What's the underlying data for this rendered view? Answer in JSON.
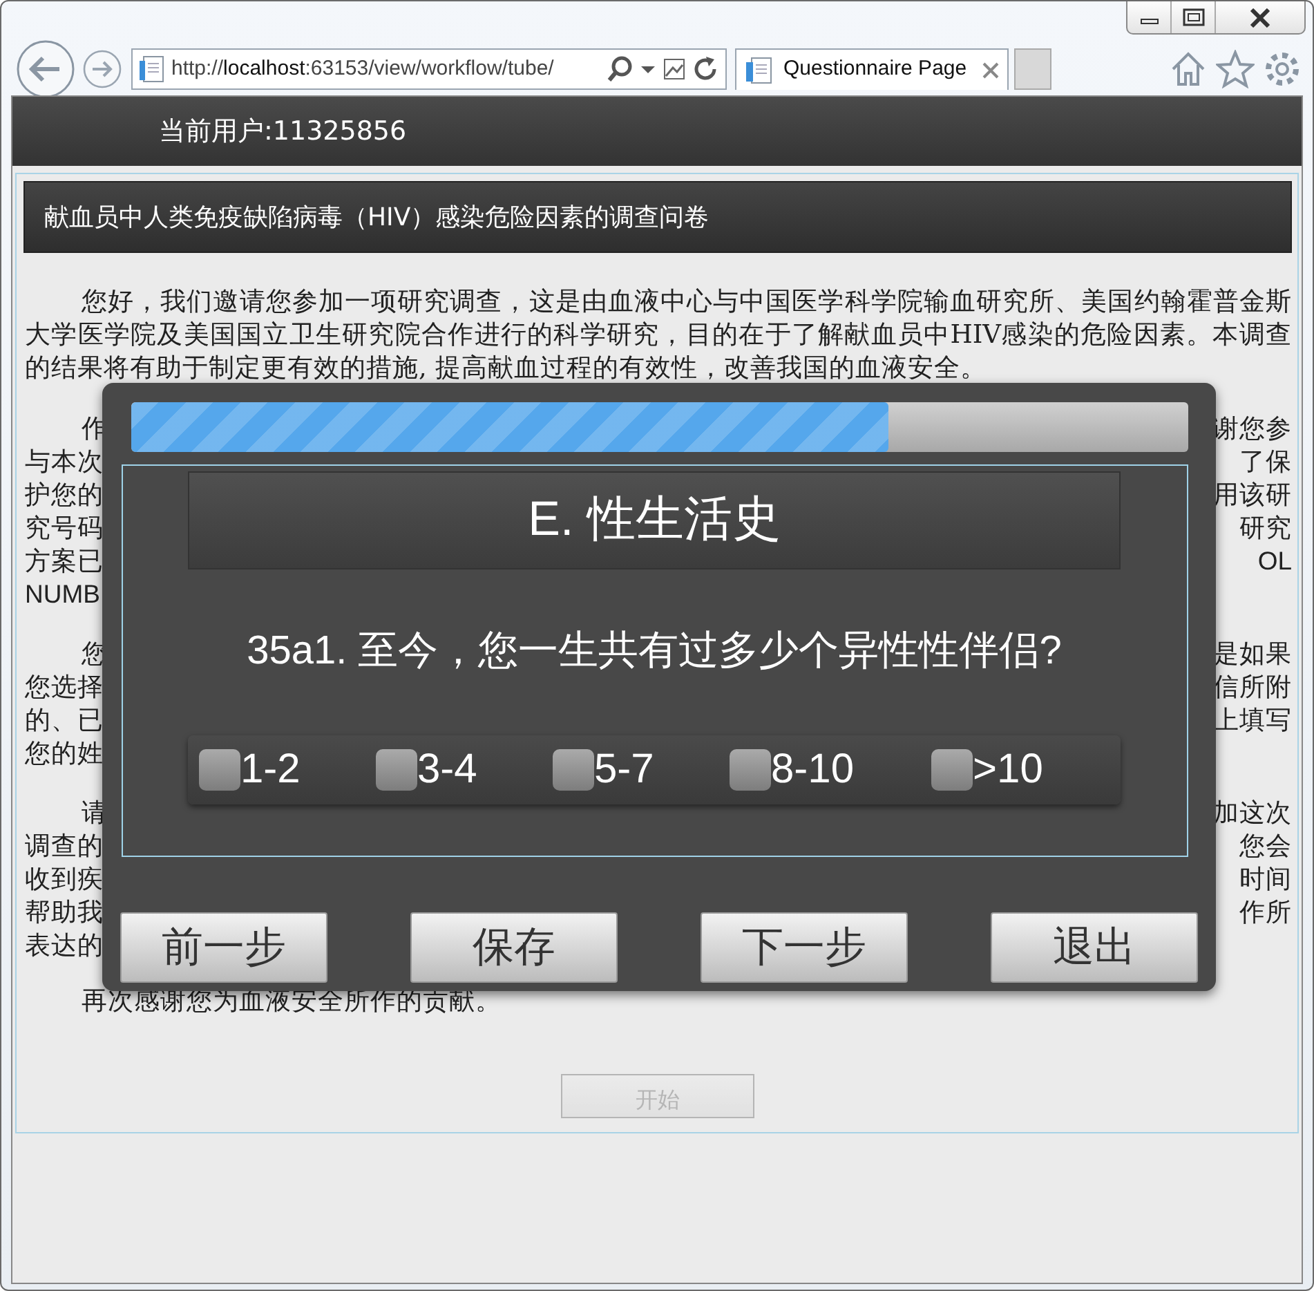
{
  "browser": {
    "address": "http://**localhost**:63153/view/workflow/tube/",
    "tabs": [
      {
        "title": "Questionnaire Page",
        "selected": true
      }
    ]
  },
  "header": {
    "user_label": "当前用户:11325856"
  },
  "survey": {
    "title": "献血员中人类免疫缺陷病毒（HIV）感染危险因素的调查问卷",
    "intro": "您好，我们邀请您参加一项研究调查，这是由血液中心与中国医学科学院输血研究所、美国约翰霍普金斯大学医学院及美国国立卫生研究院合作进行的科学研究，目的在于了解献血员中HIV感染的危险因素。本调查的结果将有助于制定更有效的措施, 提高献血过程的有效性，改善我国的血液安全。",
    "covered_paragraphs": [
      {
        "lines": [
          {
            "left": "作",
            "right": "谢您参"
          },
          {
            "left": "与本次",
            "right": "了保"
          },
          {
            "left": "护您的",
            "right": "用该研"
          },
          {
            "left": "究号码",
            "right": "研究"
          },
          {
            "left": "方案已",
            "right": "OL"
          },
          {
            "left": "NUMB"
          }
        ]
      },
      {
        "lines": [
          {
            "left": "您",
            "right": "是如果"
          },
          {
            "left": "您选择",
            "right": "信所附"
          },
          {
            "left": "的、已",
            "right": "上填写"
          },
          {
            "left": "您的姓"
          }
        ]
      },
      {
        "lines": [
          {
            "left": "请",
            "right": "加这次"
          },
          {
            "left": "调查的",
            "right": "您会"
          },
          {
            "left": "收到疾",
            "right": "时间"
          },
          {
            "left": "帮助我",
            "right": "作所"
          },
          {
            "left": "表达的"
          }
        ]
      }
    ],
    "closing": "再次感谢您为血液安全所作的贡献。",
    "start_button": {
      "label": "开始",
      "disabled": true
    }
  },
  "dialog": {
    "progress": {
      "level": 0.716
    },
    "section_title": "E. 性生活史",
    "question": "35a1. 至今，您一生共有过多少个异性性伴侣?",
    "options": [
      {
        "label": "1-2",
        "checked": false
      },
      {
        "label": "3-4",
        "checked": false
      },
      {
        "label": "5-7",
        "checked": false
      },
      {
        "label": "8-10",
        "checked": false
      },
      {
        "label": ">10",
        "checked": false
      }
    ],
    "buttons": [
      {
        "label": "前一步"
      },
      {
        "label": "保存"
      },
      {
        "label": "下一步"
      },
      {
        "label": "退出"
      }
    ]
  }
}
